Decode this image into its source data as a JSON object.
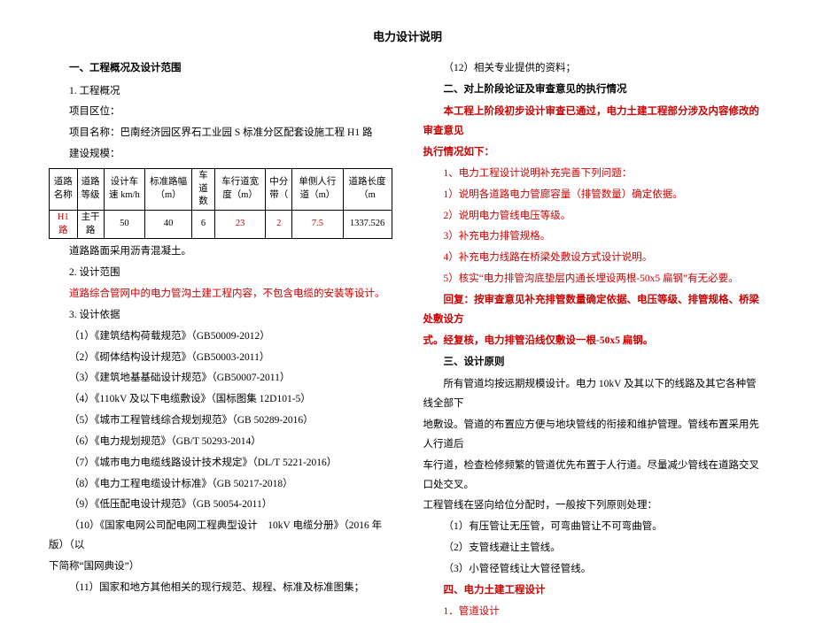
{
  "title": "电力设计说明",
  "left": {
    "s1_header": "一、工程概况及设计范围",
    "s1_1": "1. 工程概况",
    "proj_area": "项目区位：",
    "proj_name": "项目名称：巴南经济园区界石工业园 S 标准分区配套设施工程 H1 路",
    "build_scale": "建设规模：",
    "table": {
      "headers": [
        "道路名称",
        "道路等级",
        "设计车速 km/h",
        "标准路幅（m）",
        "车道数",
        "车行道宽度（m）",
        "中分带（",
        "单侧人行道（m）",
        "道路长度（m"
      ],
      "row": [
        "H1 路",
        "主干路",
        "50",
        "40",
        "6",
        "23",
        "2",
        "7.5",
        "1337.526"
      ]
    },
    "road_surface": "道路路面采用沥青混凝土。",
    "s1_2": "2. 设计范围",
    "scope": "道路综合管网中的电力管沟土建工程内容，不包含电缆的安装等设计。",
    "s1_3": "3. 设计依据",
    "refs": [
      "（1）《建筑结构荷载规范》（GB50009-2012）",
      "（2）《砌体结构设计规范》（GB50003-2011）",
      "（3）《建筑地基基础设计规范》（GB50007-2011）",
      "（4）《110kV 及以下电缆敷设》（国标图集 12D101-5）",
      "（5）《城市工程管线综合规划规范》（GB 50289-2016）",
      "（6）《电力规划规范》（GB/T 50293-2014）",
      "（7）《城市电力电缆线路设计技术规定》（DL/T 5221-2016）",
      "（8）《电力工程电缆设计标准》（GB 50217-2018）",
      "（9）《低压配电设计规范》（GB 50054-2011）"
    ],
    "ref10a": "（10）《国家电网公司配电网工程典型设计　10kV 电缆分册》（2016 年版）（以",
    "ref10b": "下简称“国网典设”）",
    "ref11": "（11）国家和地方其他相关的现行规范、规程、标准及标准图集；"
  },
  "right": {
    "r12": "（12）相关专业提供的资料；",
    "s2_header": "二、对上阶段论证及审查意见的执行情况",
    "s2_intro1": "本工程上阶段初步设计审查已通过，电力土建工程部分涉及内容修改的审查意见",
    "s2_intro2": "执行情况如下：",
    "items": [
      "1、电力工程设计说明补充完善下列问题：",
      "1）说明各道路电力管廊容量（排管数量）确定依据。",
      "2）说明电力管线电压等级。",
      "3）补充电力排管规格。",
      "4）补充电力线路在桥梁处敷设方式设计说明。",
      "5）核实“电力排管沟底垫层内通长埋设两根-50x5 扁钢”有无必要。"
    ],
    "reply1": "回复：按审查意见补充排管数量确定依据、电压等级、排管规格、桥梁处敷设方",
    "reply2": "式。经复核，电力排管沿线仅敷设一根-50x5 扁钢。",
    "s3_header": "三、设计原则",
    "p1": "所有管道均按远期规模设计。电力 10kV 及其以下的线路及其它各种管线全部下",
    "p2": "地敷设。管道的布置应方便与地块管线的衔接和维护管理。管线布置采用先人行道后",
    "p3": "车行道，检查检修频繁的管道优先布置于人行道。尽量减少管线在道路交叉口处交叉。",
    "p4": "工程管线在竖向给位分配时，一般按下列原则处理：",
    "rules": [
      "（1）有压管让无压管，可弯曲管让不可弯曲管。",
      "（2）支管线避让主管线。",
      "（3）小管径管线让大管径管线。"
    ],
    "s4_header": "四、电力土建工程设计",
    "s4_1": "1．管道设计"
  }
}
